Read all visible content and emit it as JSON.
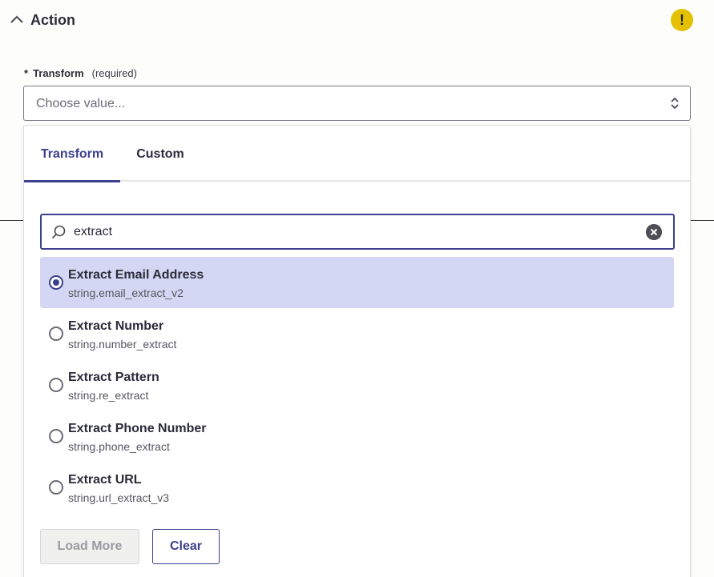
{
  "section": {
    "title": "Action",
    "collapse_icon": "chevron-up-icon",
    "warning_icon": "warning-icon",
    "warning_symbol": "!",
    "warning_color": "#e3c100"
  },
  "field": {
    "required_marker": "*",
    "label": "Transform",
    "required_hint": "(required)",
    "placeholder": "Choose value..."
  },
  "dropdown": {
    "tabs": [
      {
        "label": "Transform",
        "active": true
      },
      {
        "label": "Custom",
        "active": false
      }
    ],
    "search": {
      "value": "extract",
      "icon": "search-icon",
      "clear_icon": "clear-circle-icon"
    },
    "options": [
      {
        "title": "Extract Email Address",
        "key": "string.email_extract_v2",
        "selected": true
      },
      {
        "title": "Extract Number",
        "key": "string.number_extract",
        "selected": false
      },
      {
        "title": "Extract Pattern",
        "key": "string.re_extract",
        "selected": false
      },
      {
        "title": "Extract Phone Number",
        "key": "string.phone_extract",
        "selected": false
      },
      {
        "title": "Extract URL",
        "key": "string.url_extract_v3",
        "selected": false
      }
    ],
    "buttons": {
      "load_more": "Load More",
      "clear": "Clear"
    }
  },
  "colors": {
    "accent": "#3d3f8f",
    "selected_bg": "#d4d7f3"
  }
}
